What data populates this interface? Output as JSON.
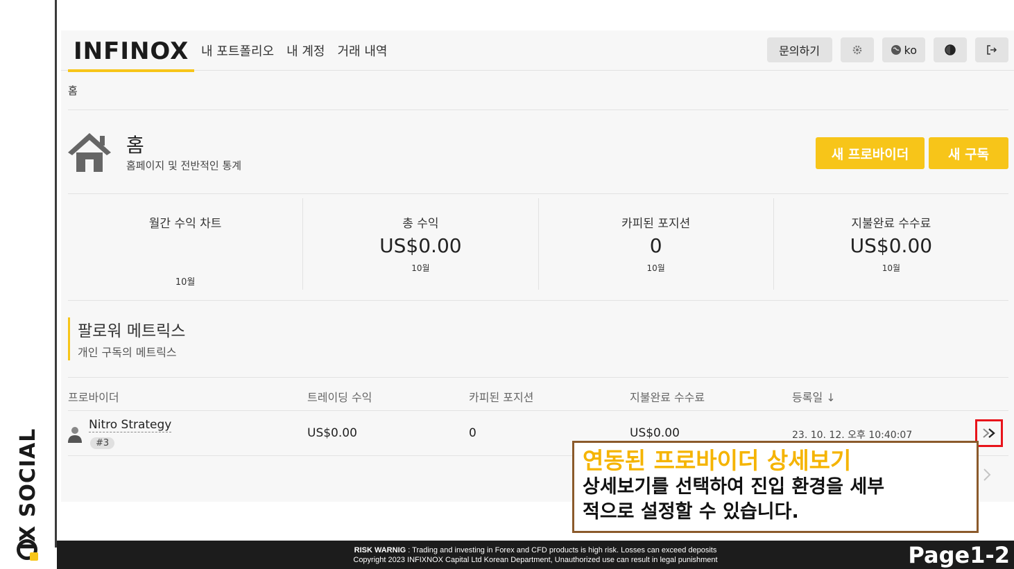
{
  "brand": {
    "vertical_text": "IX SOCIAL"
  },
  "header": {
    "logo": "INFINOX",
    "nav": [
      "내 포트폴리오",
      "내 계정",
      "거래 내역"
    ],
    "inquiry_label": "문의하기",
    "language_label": "ko",
    "icons": [
      "gear-icon",
      "globe-icon",
      "contrast-icon",
      "logout-icon"
    ]
  },
  "breadcrumb": "홈",
  "page": {
    "title": "홈",
    "subtitle": "홈페이지 및 전반적인 통계",
    "new_provider_label": "새 프로바이더",
    "new_subscription_label": "새 구독"
  },
  "stats": [
    {
      "label": "월간 수익 차트",
      "value": "",
      "sub": "10월"
    },
    {
      "label": "총 수익",
      "value": "US$0.00",
      "sub": "10월"
    },
    {
      "label": "카피된 포지션",
      "value": "0",
      "sub": "10월"
    },
    {
      "label": "지불완료 수수료",
      "value": "US$0.00",
      "sub": "10월"
    }
  ],
  "section": {
    "title": "팔로워 메트릭스",
    "subtitle": "개인 구독의 메트릭스"
  },
  "table": {
    "columns": [
      "프로바이더",
      "트레이딩 수익",
      "카피된 포지션",
      "지불완료 수수료",
      "등록일 ↓"
    ],
    "rows": [
      {
        "provider": "Nitro Strategy",
        "rank": "#3",
        "profit": "US$0.00",
        "copied": "0",
        "fees": "US$0.00",
        "registered": "23. 10. 12. 오후 10:40:07"
      }
    ]
  },
  "callout": {
    "title": "연동된 프로바이더 상세보기",
    "body_line1": "상세보기를 선택하여 진입 환경을 세부",
    "body_line2": "적으로 설정할 수 있습니다."
  },
  "footer": {
    "warning_label": "RISK WARNIG",
    "warning_text": " : Trading and investing in Forex and CFD products is high risk. Losses can exceed deposits",
    "copyright": "Copyright 2023 INFIXNOX Capital Ltd Korean Department, Unauthorized use can result in legal punishment",
    "page_number": "Page1-2"
  },
  "colors": {
    "accent": "#f7c519",
    "highlight": "#e8141b",
    "callout_border": "#8b5a2b"
  }
}
